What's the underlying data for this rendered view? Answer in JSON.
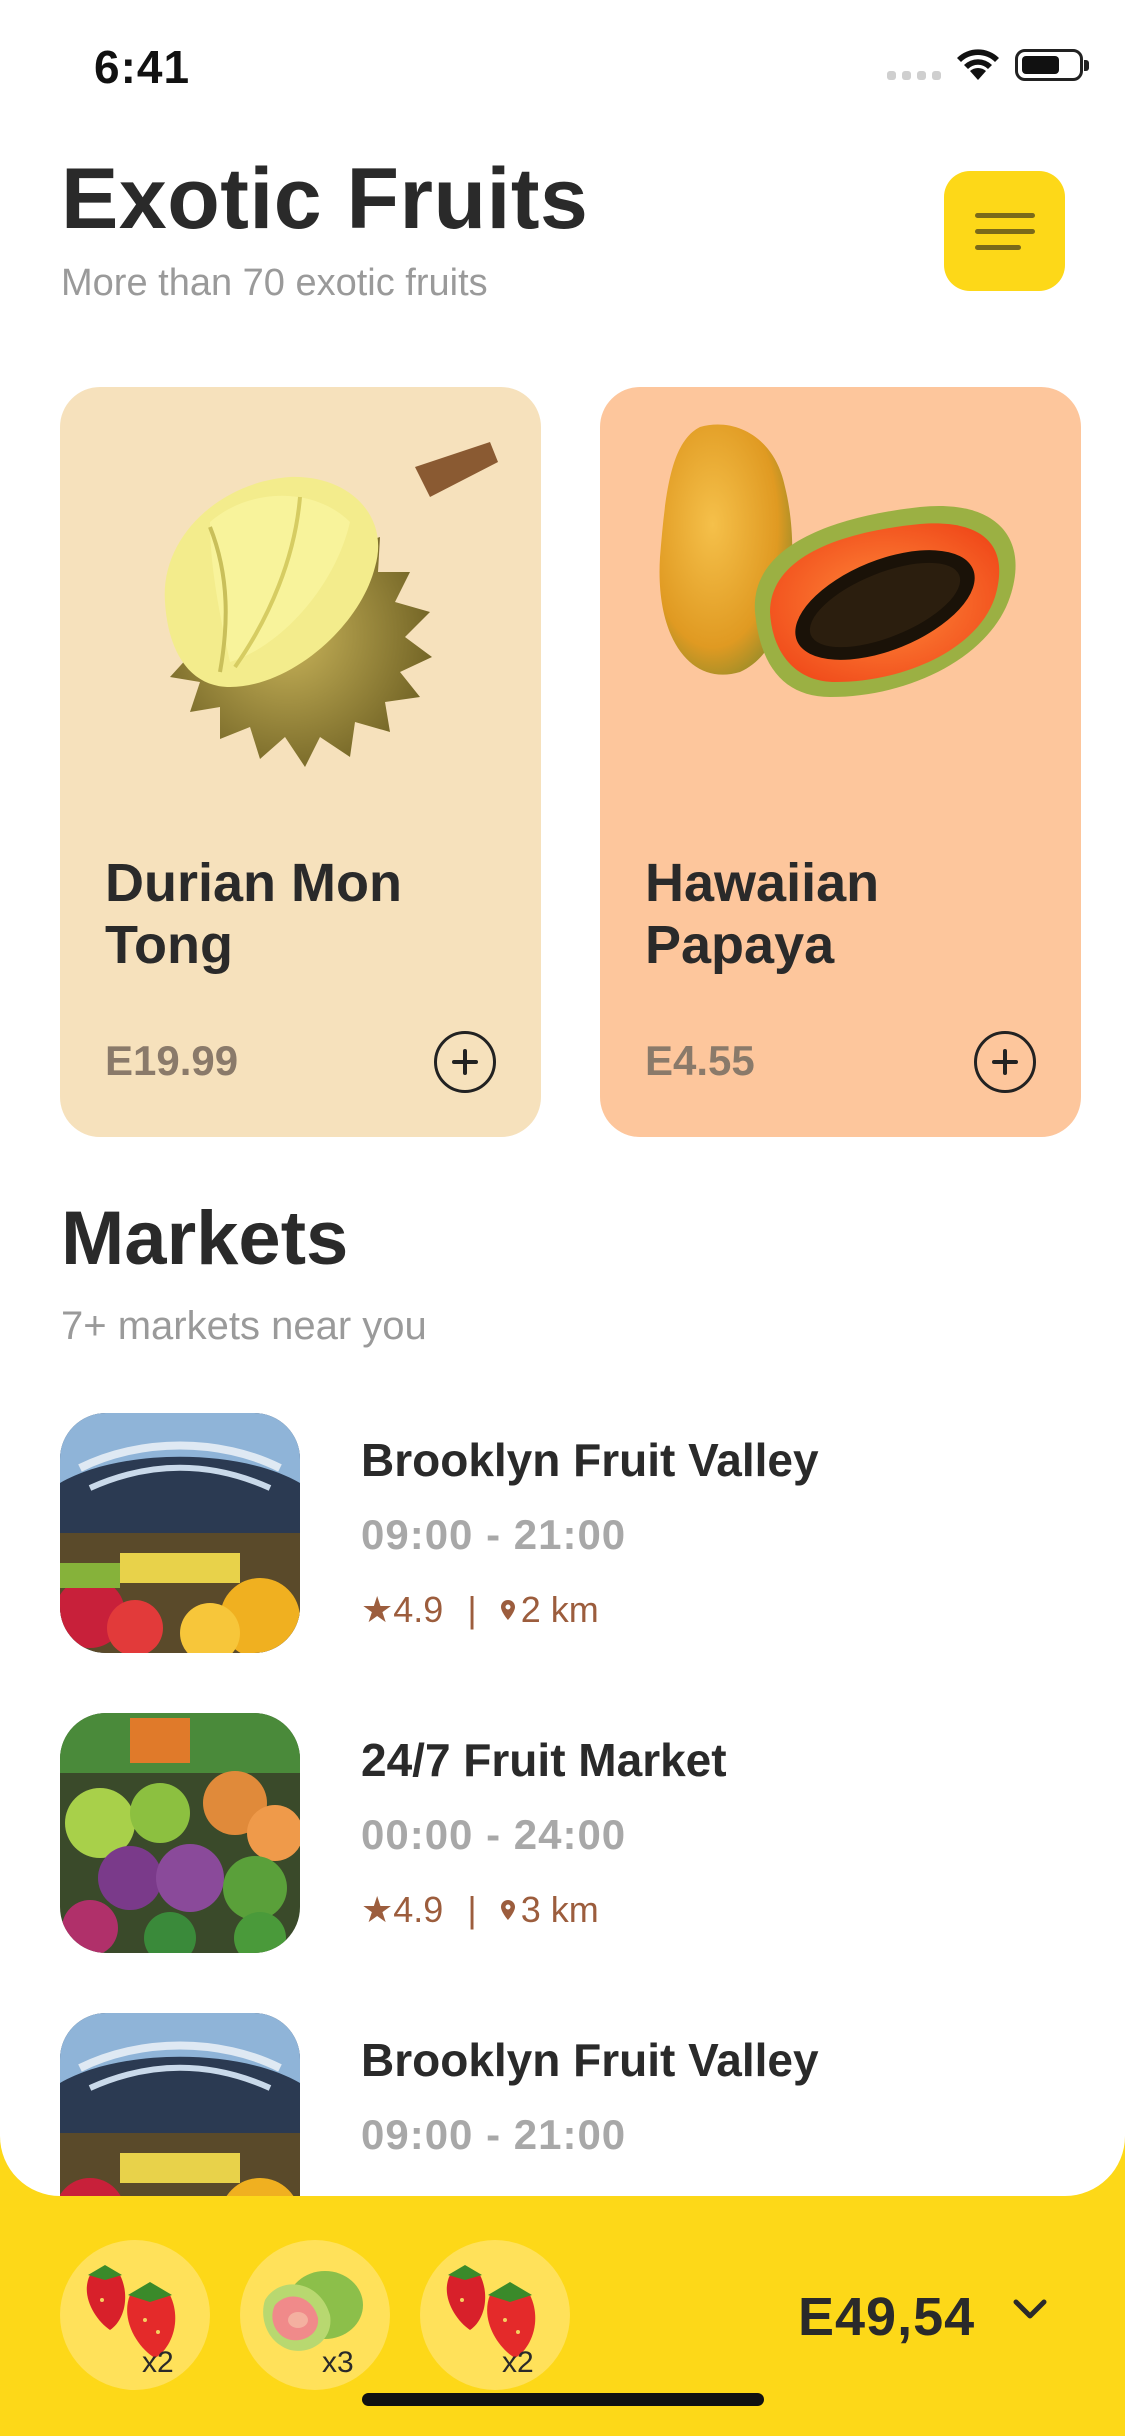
{
  "status": {
    "time": "6:41"
  },
  "header": {
    "title": "Exotic Fruits",
    "subtitle": "More than 70 exotic fruits",
    "menu_icon": "menu-icon"
  },
  "fruits": [
    {
      "name": "Durian Mon Tong",
      "price": "E19.99",
      "bg": "#F6E1BC",
      "image": "durian-image"
    },
    {
      "name": "Hawaiian Papaya",
      "price": "E4.55",
      "bg": "#FDC69C",
      "image": "papaya-image"
    }
  ],
  "markets": {
    "title": "Markets",
    "subtitle": "7+ markets near you",
    "items": [
      {
        "name": "Brooklyn Fruit Valley",
        "hours": "09:00 - 21:00",
        "rating": "★4.9",
        "sep": "|",
        "distance": "2 km"
      },
      {
        "name": "24/7 Fruit Market",
        "hours": "00:00 - 24:00",
        "rating": "★4.9",
        "sep": "|",
        "distance": "3 km"
      },
      {
        "name": "Brooklyn Fruit Valley",
        "hours": "09:00 - 21:00"
      }
    ]
  },
  "cart": {
    "items": [
      {
        "fruit": "strawberry",
        "qty": "x2"
      },
      {
        "fruit": "guava",
        "qty": "x3"
      },
      {
        "fruit": "strawberry",
        "qty": "x2"
      }
    ],
    "total": "E49,54"
  },
  "colors": {
    "accent": "#FDD818",
    "meta": "#9c5d3d"
  }
}
